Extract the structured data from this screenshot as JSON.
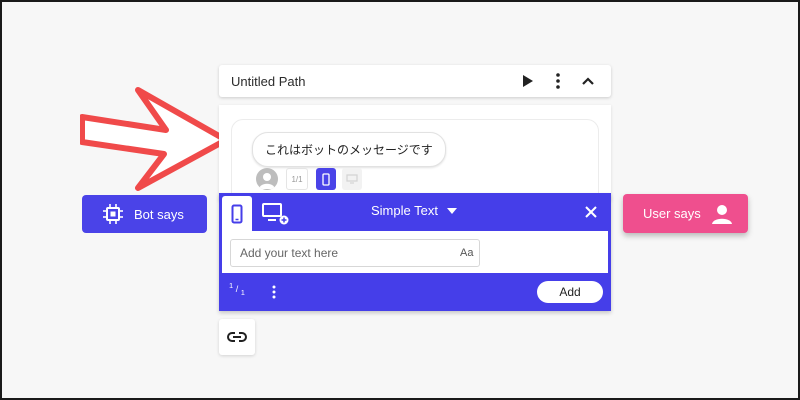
{
  "path": {
    "title": "Untitled Path",
    "icons": {
      "play": "play-icon",
      "more": "more-vert-icon",
      "collapse": "chevron-up-icon"
    }
  },
  "message": {
    "bubble_text": "これはボットのメッセージです",
    "counter": "1/1"
  },
  "editor": {
    "type_label": "Simple Text",
    "input_placeholder": "Add your text here",
    "format_label": "Aa",
    "page_current": "1",
    "page_total": "1",
    "add_label": "Add"
  },
  "sidebar": {
    "bot_label": "Bot says",
    "user_label": "User says"
  },
  "colors": {
    "accent": "#453ee9",
    "user": "#ef4f8e",
    "arrow": "#f04a4a"
  }
}
